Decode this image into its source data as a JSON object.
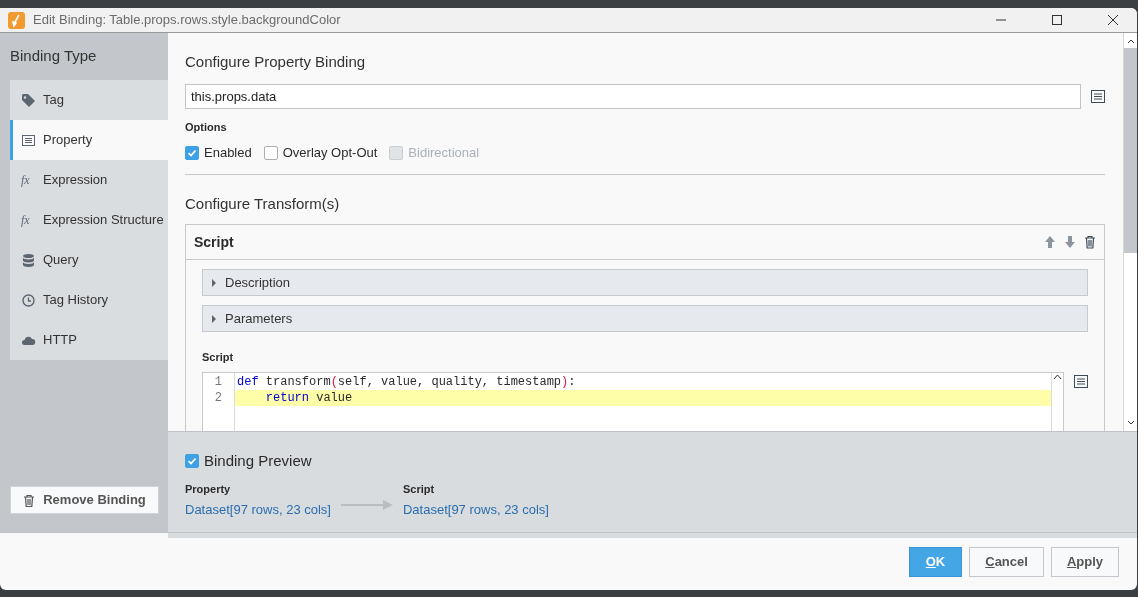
{
  "window": {
    "title": "Edit Binding: Table.props.rows.style.backgroundColor"
  },
  "sidebar": {
    "title": "Binding Type",
    "items": [
      {
        "label": "Tag",
        "selected": false
      },
      {
        "label": "Property",
        "selected": true
      },
      {
        "label": "Expression",
        "glyph": "fx",
        "selected": false
      },
      {
        "label": "Expression Structure",
        "glyph": "fx",
        "selected": false
      },
      {
        "label": "Query",
        "selected": false
      },
      {
        "label": "Tag History",
        "selected": false
      },
      {
        "label": "HTTP",
        "selected": false
      }
    ],
    "remove_button": "Remove Binding"
  },
  "property_binding": {
    "heading": "Configure Property Binding",
    "path": "this.props.data",
    "options_label": "Options",
    "options": [
      {
        "label": "Enabled",
        "checked": true,
        "disabled": false
      },
      {
        "label": "Overlay Opt-Out",
        "checked": false,
        "disabled": false
      },
      {
        "label": "Bidirectional",
        "checked": false,
        "disabled": true
      }
    ]
  },
  "transforms": {
    "heading": "Configure Transform(s)",
    "panel_title": "Script",
    "sections": [
      {
        "label": "Description",
        "expanded": false
      },
      {
        "label": "Parameters",
        "expanded": false
      }
    ],
    "script_label": "Script",
    "code_lines": [
      {
        "number": "1",
        "highlighted": false,
        "tokens": [
          {
            "text": "def",
            "kind": "keyword"
          },
          {
            "text": " transform",
            "kind": "plain"
          },
          {
            "text": "(",
            "kind": "paren"
          },
          {
            "text": "self, value, quality, timestamp",
            "kind": "plain"
          },
          {
            "text": ")",
            "kind": "paren"
          },
          {
            "text": ":",
            "kind": "plain"
          }
        ]
      },
      {
        "number": "2",
        "highlighted": true,
        "tokens": [
          {
            "text": "    return",
            "kind": "keyword"
          },
          {
            "text": " value",
            "kind": "plain"
          }
        ]
      }
    ]
  },
  "preview": {
    "label": "Binding Preview",
    "checked": true,
    "source_label": "Property",
    "source_value": "Dataset[97 rows, 23 cols]",
    "target_label": "Script",
    "target_value": "Dataset[97 rows, 23 cols]"
  },
  "buttons": [
    {
      "label": "OK",
      "kind": "primary"
    },
    {
      "label": "Cancel",
      "kind": "secondary"
    },
    {
      "label": "Apply",
      "kind": "secondary"
    }
  ]
}
